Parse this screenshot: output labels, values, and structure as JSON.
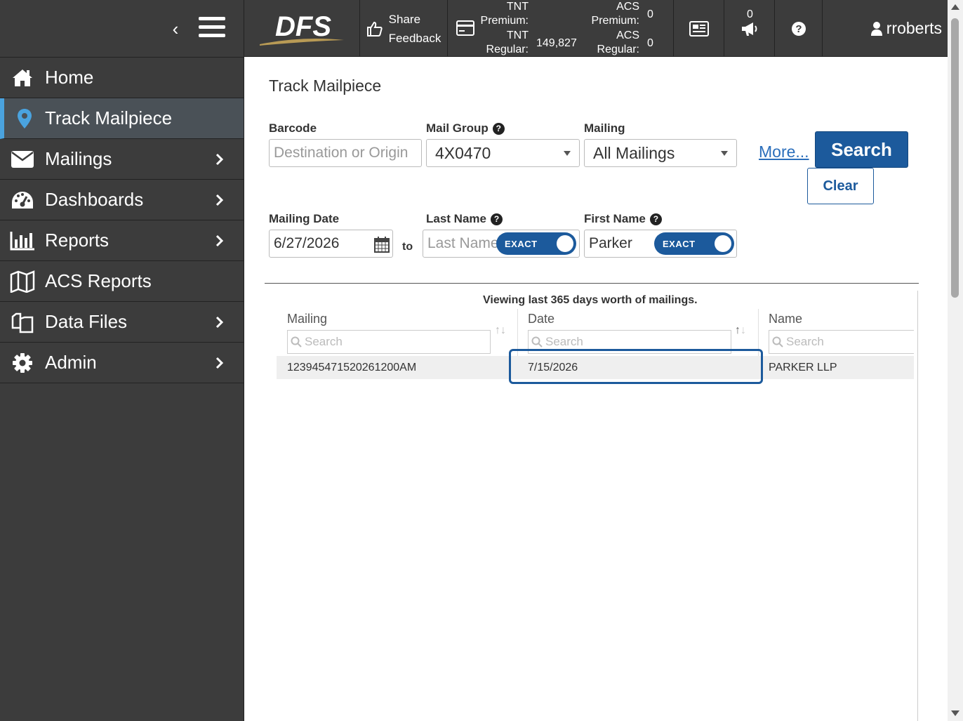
{
  "header": {
    "logo_text": "DFS",
    "feedback_line1": "Share",
    "feedback_line2": "Feedback",
    "tnt_premium_label": "TNT Premium:",
    "tnt_premium_value": "0",
    "tnt_regular_label": "TNT Regular:",
    "tnt_regular_value": "149,827",
    "acs_premium_label": "ACS Premium:",
    "acs_premium_value": "0",
    "acs_regular_label": "ACS Regular:",
    "acs_regular_value": "0",
    "username": "rroberts"
  },
  "sidebar": {
    "items": [
      {
        "label": "Home",
        "icon": "home-icon"
      },
      {
        "label": "Track Mailpiece",
        "icon": "map-pin-icon",
        "active": true
      },
      {
        "label": "Mailings",
        "icon": "envelope-icon"
      },
      {
        "label": "Dashboards",
        "icon": "dashboard-icon"
      },
      {
        "label": "Reports",
        "icon": "bar-chart-icon"
      },
      {
        "label": "ACS Reports",
        "icon": "map-icon"
      },
      {
        "label": "Data Files",
        "icon": "files-icon"
      },
      {
        "label": "Admin",
        "icon": "gear-icon"
      }
    ]
  },
  "form": {
    "title": "Track Mailpiece",
    "barcode_label": "Barcode",
    "barcode_placeholder": "Destination or Origin",
    "mail_group_label": "Mail Group",
    "mail_group_value": "4X0470",
    "mailing_label": "Mailing",
    "mailing_value": "All Mailings",
    "more_link": "More...",
    "search_button": "Search",
    "clear_button": "Clear",
    "mailing_date_label": "Mailing Date",
    "mailing_date_value": "6/27/2026",
    "to_label": "to",
    "last_name_label": "Last Name",
    "last_name_placeholder": "Last Name",
    "last_name_toggle": "EXACT",
    "first_name_label": "First Name",
    "first_name_value": "Parker",
    "first_name_toggle": "EXACT"
  },
  "results": {
    "info": "Viewing last 365 days worth of mailings.",
    "columns": [
      {
        "label": "Mailing",
        "filter_placeholder": "Search"
      },
      {
        "label": "Date",
        "filter_placeholder": "Search"
      },
      {
        "label": "Name",
        "filter_placeholder": "Search"
      }
    ],
    "rows": [
      {
        "mailing": "12394547152026120​0AM",
        "date": "7/15/2026",
        "name": "PARKER LLP"
      }
    ]
  },
  "colors": {
    "sidebar_bg": "#3c3c3c",
    "active_accent": "#4aa3df",
    "primary": "#1c5a9c",
    "link": "#2a6ebb"
  }
}
